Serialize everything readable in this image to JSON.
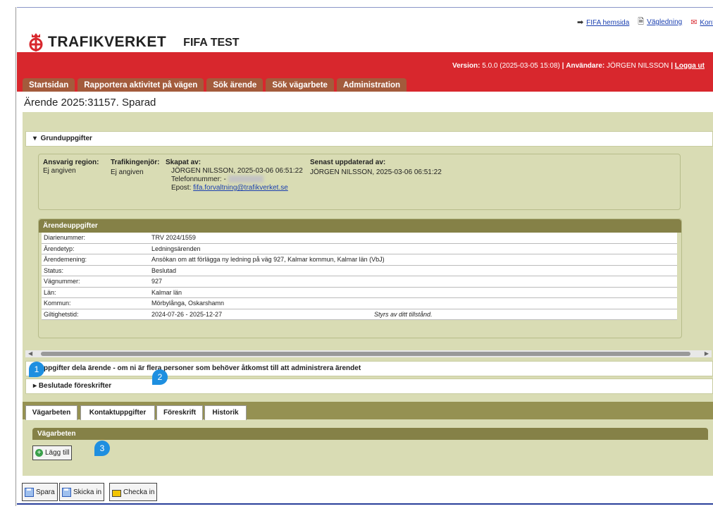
{
  "toplinks": [
    {
      "label": "FIFA hemsida",
      "icon": "arrow-right-icon"
    },
    {
      "label": "Vägledning",
      "icon": "document-icon"
    },
    {
      "label": "Kont",
      "icon": "mail-icon"
    }
  ],
  "header": {
    "brand": "TRAFIKVERKET",
    "app": "FIFA TEST"
  },
  "version": {
    "label": "Version:",
    "value": "5.0.0 (2025-03-05 15:08)",
    "sep1": "|",
    "user_label": "Användare:",
    "user": "JÖRGEN NILSSON",
    "sep2": "|",
    "logout": "Logga ut"
  },
  "nav": [
    "Startsidan",
    "Rapportera aktivitet på vägen",
    "Sök ärende",
    "Sök vägarbete",
    "Administration"
  ],
  "case_title": "Ärende 2025:31157. Sparad",
  "grund": {
    "title": "Grunduppgifter",
    "region_h": "Ansvarig region:",
    "region": "Ej angiven",
    "traf_h": "Trafikingenjör:",
    "traf": "Ej angiven",
    "skapat_h": "Skapat av:",
    "skapat": "JÖRGEN NILSSON, 2025-03-06 06:51:22",
    "tel": "Telefonnummer: -",
    "epost_label": "Epost:",
    "epost": "fifa.forvaltning@trafikverket.se",
    "upd_h": "Senast uppdaterad av:",
    "upd": "JÖRGEN NILSSON, 2025-03-06 06:51:22"
  },
  "arende": {
    "title": "Ärendeuppgifter",
    "rows": [
      {
        "label": "Diarienummer:",
        "value": "TRV 2024/1559"
      },
      {
        "label": "Ärendetyp:",
        "value": "Ledningsärenden"
      },
      {
        "label": "Ärendemening:",
        "value": "Ansökan om att förlägga ny ledning på väg 927, Kalmar kommun, Kalmar län (VbJ)"
      },
      {
        "label": "Status:",
        "value": "Beslutad"
      },
      {
        "label": "Vägnummer:",
        "value": "927"
      },
      {
        "label": "Län:",
        "value": "Kalmar län"
      },
      {
        "label": "Kommun:",
        "value": "Mörbylånga, Oskarshamn"
      },
      {
        "label": "Giltighetstid:",
        "value": "2024-07-26 - 2025-12-27"
      }
    ],
    "note": "Styrs av ditt tillstånd."
  },
  "sections": {
    "share": "Uppgifter dela ärende - om ni är flera personer som behöver åtkomst till att administrera ärendet",
    "beslutade": "Beslutade föreskrifter"
  },
  "bottom_tabs": [
    "Vägarbeten",
    "Kontaktuppgifter",
    "Föreskrift",
    "Historik"
  ],
  "vagarbeten": {
    "title": "Vägarbeten",
    "add": "Lägg till"
  },
  "actions": {
    "save": "Spara",
    "send": "Skicka in",
    "checkin": "Checka in"
  },
  "markers": [
    "1",
    "2",
    "3"
  ],
  "colors": {
    "red": "#d8272d",
    "tab": "#a35b3c",
    "olive": "#858147",
    "bg": "#d9dcb4"
  }
}
